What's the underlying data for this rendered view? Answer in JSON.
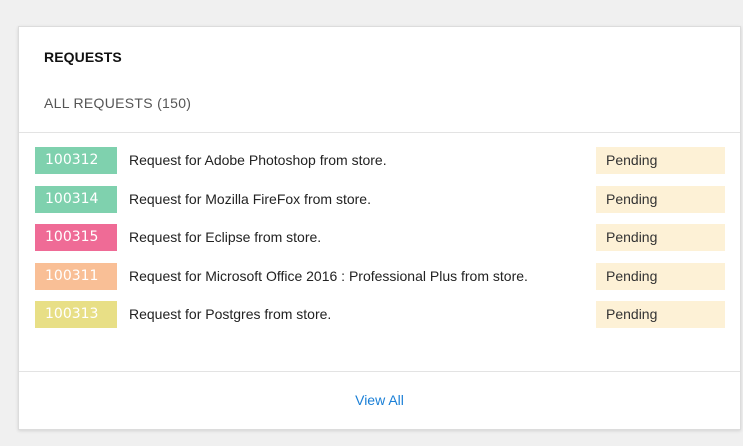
{
  "card": {
    "title": "REQUESTS",
    "subtitle": "ALL REQUESTS (150)",
    "view_all_label": "View All"
  },
  "requests": [
    {
      "id": "100312",
      "description": "Request for Adobe Photoshop from store.",
      "status": "Pending",
      "color": "#7fd1ae"
    },
    {
      "id": "100314",
      "description": "Request for Mozilla FireFox from store.",
      "status": "Pending",
      "color": "#7fd1ae"
    },
    {
      "id": "100315",
      "description": "Request for Eclipse from store.",
      "status": "Pending",
      "color": "#ef6b96"
    },
    {
      "id": "100311",
      "description": "Request for Microsoft Office 2016 : Professional Plus from store.",
      "status": "Pending",
      "color": "#f9bf96"
    },
    {
      "id": "100313",
      "description": "Request for Postgres from store.",
      "status": "Pending",
      "color": "#e8df86"
    }
  ],
  "colors": {
    "status_background": "#fdf1d6",
    "link": "#1a7fd6"
  }
}
